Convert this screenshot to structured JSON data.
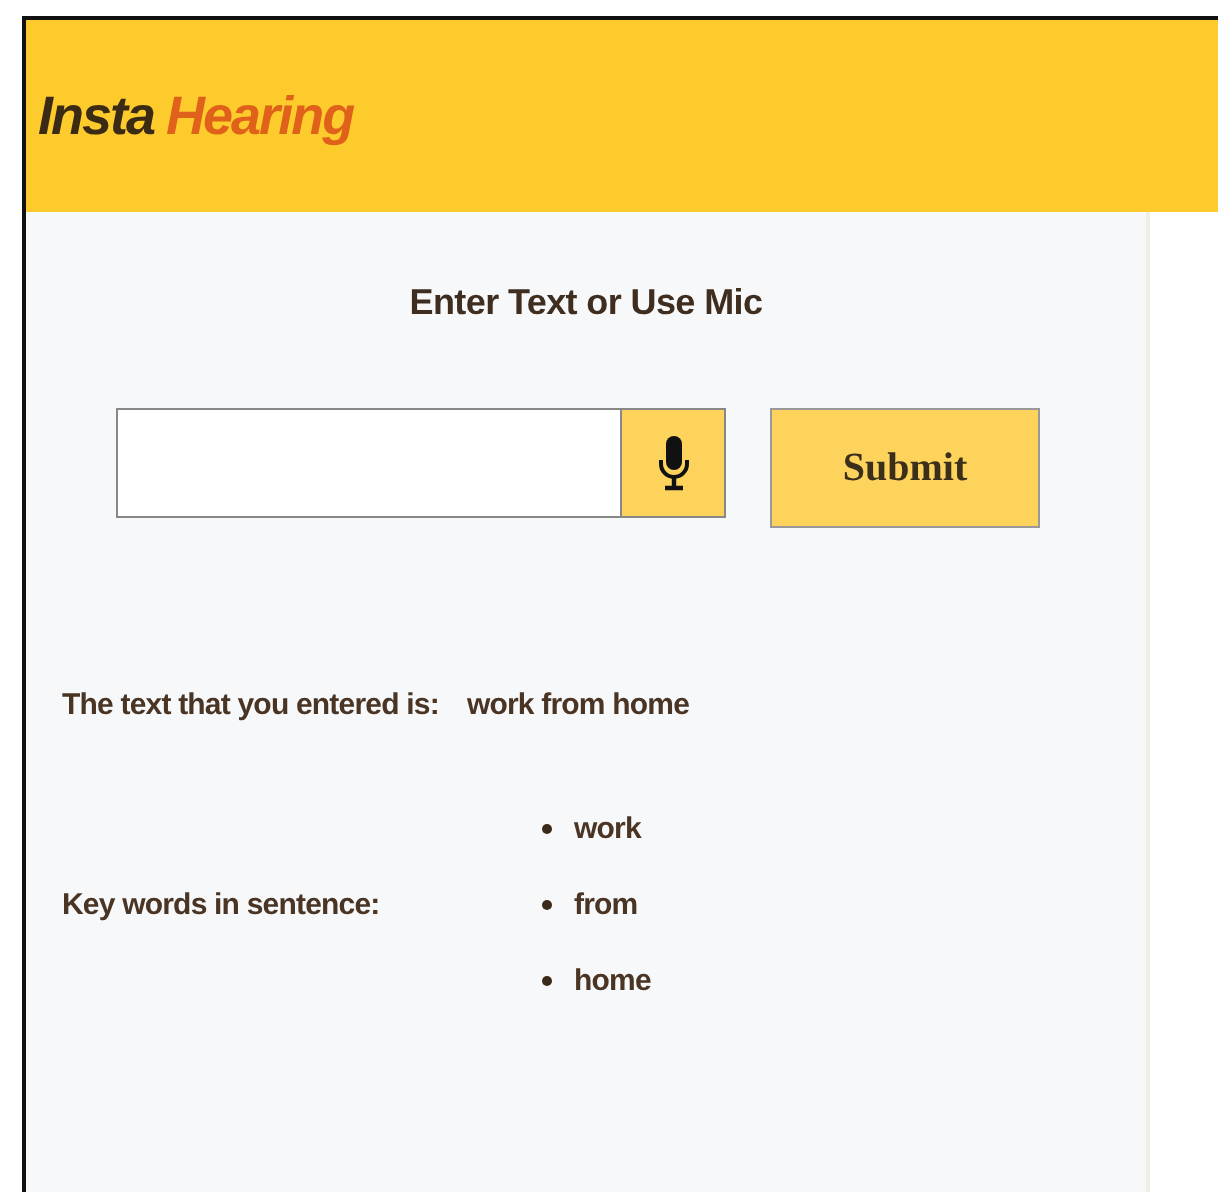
{
  "header": {
    "brand_first": "Insta",
    "brand_second": "Hearing"
  },
  "heading": "Enter Text or Use Mic",
  "submit": "Submit",
  "result": {
    "label": "The text that you entered is:",
    "value": "work from home"
  },
  "keywords": {
    "label": "Key words in sentence:",
    "items": [
      "work",
      "from",
      "home"
    ]
  }
}
